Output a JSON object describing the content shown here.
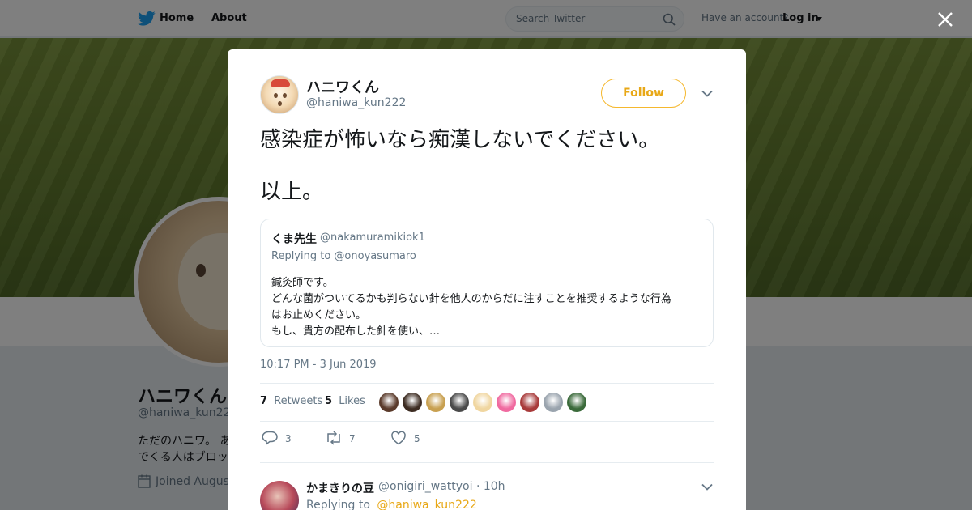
{
  "nav": {
    "home_label": "Home",
    "about_label": "About",
    "search_placeholder": "Search Twitter",
    "account_text": "Have an account?",
    "login_label": "Log in"
  },
  "profile": {
    "name": "ハニワくん",
    "handle": "@haniwa_kun222",
    "bio_line1": "ただのハニワ。 あ",
    "bio_line2": "でくる人はブロッ",
    "joined": "Joined August"
  },
  "tweet": {
    "author_name": "ハニワくん",
    "author_handle": "@haniwa_kun222",
    "follow_label": "Follow",
    "text_line1": "感染症が怖いなら痴漢しないでください。",
    "text_line2": "以上。",
    "timestamp": "10:17 PM - 3 Jun 2019",
    "retweets_count": "7",
    "retweets_label": "Retweets",
    "likes_count": "5",
    "likes_label": "Likes",
    "reply_count": "3",
    "retweet_count": "7",
    "like_count": "5"
  },
  "quoted": {
    "name": "くま先生",
    "handle": "@nakamuramikiok1",
    "replying_to": "Replying to @onoyasumaro",
    "lines": [
      "鍼灸師です。",
      "どんな菌がついてるかも判らない針を他人のからだに注すことを推奨するような行為",
      "はお止めください。",
      "もし、貴方の配布した針を使い、…"
    ]
  },
  "reply": {
    "name": "かまきりの豆",
    "handle_time": "@onigiri_wattyoi · 10h",
    "replying_prefix": "Replying to",
    "replying_handle": "@haniwa_kun222"
  },
  "colors": {
    "accent": "#e8a817",
    "twitter_blue": "#1da1f2",
    "text_secondary": "#657786"
  },
  "likers": [
    "#5a3a2a",
    "#3d2c22",
    "#c8a050",
    "#4a4a4a",
    "#f0d6a0",
    "#f06aa0",
    "#a83a3a",
    "#9aa4ae",
    "#3a6a3a"
  ]
}
